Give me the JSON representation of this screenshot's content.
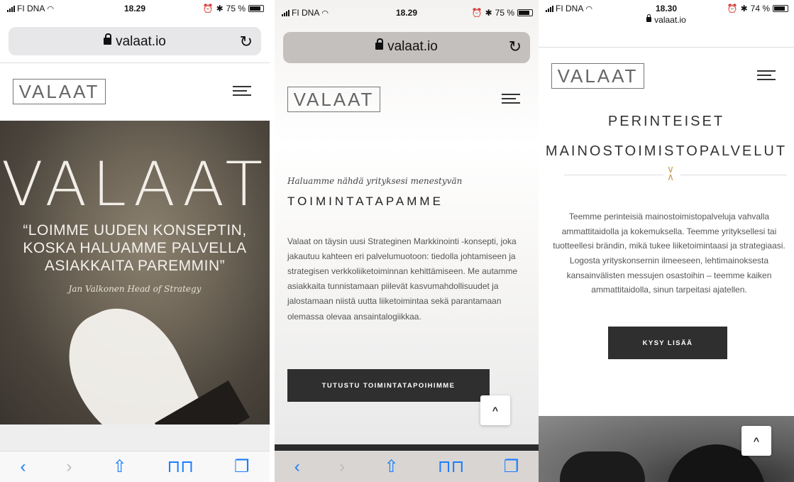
{
  "screens": [
    {
      "status": {
        "carrier": "FI DNA",
        "time": "18.29",
        "battery": "75 %"
      },
      "url": "valaat.io",
      "logo": "VALAAT",
      "hero": {
        "logo": "VALAAT",
        "quote": "“LOIMME UUDEN KONSEPTIN, KOSKA HALUAMME PALVELLA ASIAKKAITA PAREMMIN”",
        "author": "Jan Valkonen Head of Strategy"
      }
    },
    {
      "status": {
        "carrier": "FI DNA",
        "time": "18.29",
        "battery": "75 %"
      },
      "url": "valaat.io",
      "logo": "VALAAT",
      "tagline": "Haluamme nähdä yrityksesi menestyvän",
      "title": "TOIMINTATAPAMME",
      "body": "Valaat on täysin uusi Strateginen Markkinointi -konsepti, joka jakautuu kahteen eri palvelumuotoon: tiedolla johtamiseen ja strategisen verkkoliiketoiminnan kehittämiseen. Me autamme asiakkaita tunnistamaan piilevät kasvumahdollisuudet ja jalostamaan niistä uutta liiketoimintaa sekä parantamaan olemassa olevaa ansaintalogiikkaa.",
      "button": "TUTUSTU TOIMINTATAPOIHIMME"
    },
    {
      "status": {
        "carrier": "FI DNA",
        "time": "18.30",
        "battery": "74 %"
      },
      "url": "valaat.io",
      "logo": "VALAAT",
      "title_line1": "PERINTEISET",
      "title_line2": "MAINOSTOIMISTOPALVELUT",
      "body": "Teemme perinteisiä mainostoimistopalveluja vahvalla ammattitaidolla ja kokemuksella. Teemme yrityksellesi tai tuotteellesi brändin, mikä tukee liiketoimintaasi ja strategiaasi. Logosta yrityskonsernin ilmeeseen, lehtimainoksesta kansainvälisten messujen osastoihin – teemme kaiken ammattitaidolla, sinun tarpeitasi ajatellen.",
      "button": "KYSY LISÄÄ"
    }
  ],
  "toolbar": {
    "back": "‹",
    "forward": "›",
    "share": "⇧",
    "bookmarks": "📖",
    "tabs": "❐"
  },
  "icons": {
    "reload": "↻",
    "scroll_top": "^",
    "chevrons": "∨∧"
  },
  "colors": {
    "button": "#2f2f2f",
    "accent": "#c9a15a",
    "link": "#1a7dff"
  }
}
